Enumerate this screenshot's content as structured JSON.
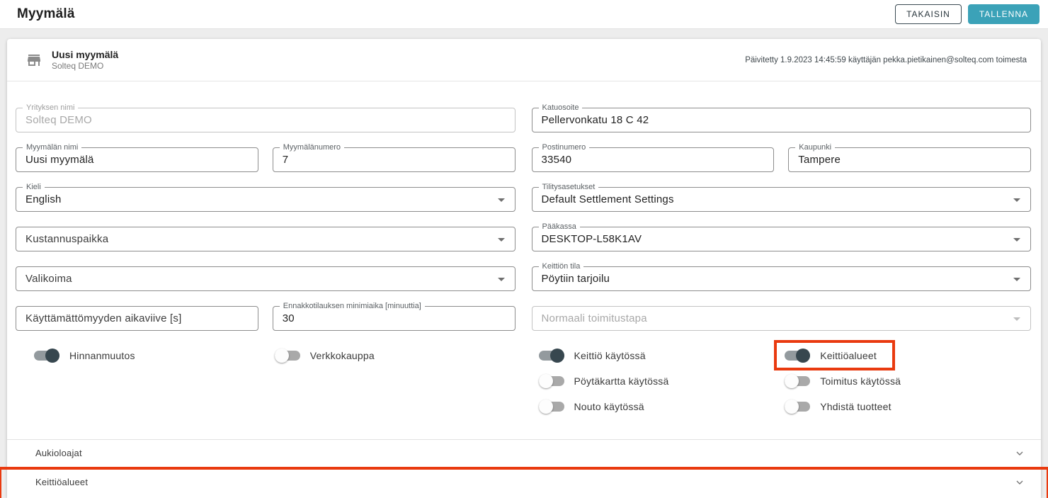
{
  "topbar": {
    "title": "Myymälä",
    "back": "TAKAISIN",
    "save": "TALLENNA"
  },
  "card_header": {
    "name": "Uusi myymälä",
    "company": "Solteq DEMO",
    "updated": "Päivitetty 1.9.2023 14:45:59 käyttäjän pekka.pietikainen@solteq.com toimesta"
  },
  "form": {
    "company_name": {
      "label": "Yrityksen nimi",
      "value": "Solteq DEMO",
      "disabled": true
    },
    "store_name": {
      "label": "Myymälän nimi",
      "value": "Uusi myymälä"
    },
    "store_number": {
      "label": "Myymälänumero",
      "value": "7"
    },
    "language": {
      "label": "Kieli",
      "value": "English"
    },
    "cost_center": {
      "label": "Kustannuspaikka",
      "value": ""
    },
    "assortment": {
      "label": "Valikoima",
      "value": ""
    },
    "idle_delay": {
      "label": "Käyttämättömyyden aikaviive [s]",
      "value": ""
    },
    "preorder_min": {
      "label": "Ennakkotilauksen minimiaika [minuuttia]",
      "value": "30"
    },
    "street_address": {
      "label": "Katuosoite",
      "value": "Pellervonkatu 18 C 42"
    },
    "postal_code": {
      "label": "Postinumero",
      "value": "33540"
    },
    "city": {
      "label": "Kaupunki",
      "value": "Tampere"
    },
    "settlement": {
      "label": "Tilitysasetukset",
      "value": "Default Settlement Settings"
    },
    "main_register": {
      "label": "Pääkassa",
      "value": "DESKTOP-L58K1AV"
    },
    "kitchen_state": {
      "label": "Keittiön tila",
      "value": "Pöytiin tarjoilu"
    },
    "delivery_method": {
      "label": "Normaali toimitustapa",
      "value": "",
      "disabled": true
    }
  },
  "toggles": {
    "price_change": {
      "label": "Hinnanmuutos",
      "on": true
    },
    "webshop": {
      "label": "Verkkokauppa",
      "on": false
    },
    "kitchen_enabled": {
      "label": "Keittiö käytössä",
      "on": true
    },
    "kitchen_areas": {
      "label": "Keittiöalueet",
      "on": true,
      "highlighted": true
    },
    "table_map": {
      "label": "Pöytäkartta käytössä",
      "on": false
    },
    "delivery_enabled": {
      "label": "Toimitus käytössä",
      "on": false
    },
    "pickup_enabled": {
      "label": "Nouto käytössä",
      "on": false
    },
    "combine_products": {
      "label": "Yhdistä tuotteet",
      "on": false
    }
  },
  "accordions": {
    "opening_hours": "Aukioloajat",
    "kitchen_areas": "Keittiöalueet"
  },
  "colors": {
    "accent_teal": "#3ba2b8",
    "highlight_red": "#e93a0f",
    "toggle_on": "#37474f"
  }
}
